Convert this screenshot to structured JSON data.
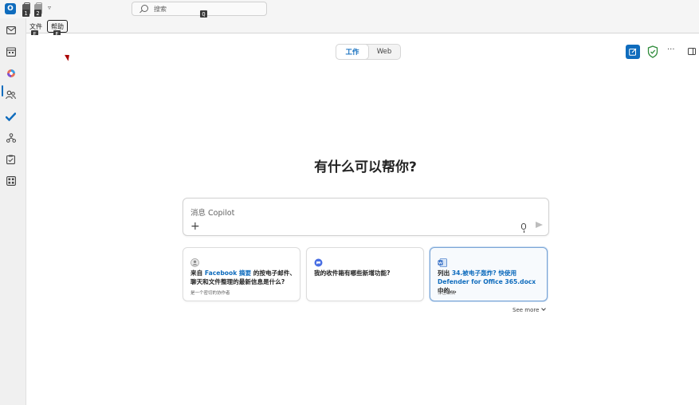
{
  "app": {
    "logo_letter": "O"
  },
  "quick_access": {
    "keytip_1": "1",
    "keytip_2": "2",
    "more": "▿"
  },
  "search": {
    "placeholder": "搜索",
    "keytip": "Q"
  },
  "menu": {
    "file_label": "文件",
    "file_keytip": "F",
    "help_label": "帮助",
    "help_keytip": "E"
  },
  "rail": {
    "items": [
      "mail-icon",
      "calendar-icon",
      "copilot-icon",
      "people-icon",
      "todo-icon",
      "org-icon",
      "tasks-icon",
      "apps-icon"
    ],
    "active": "copilot-icon"
  },
  "toolbar": {
    "tabs": [
      {
        "label": "工作",
        "active": true
      },
      {
        "label": "Web",
        "active": false
      }
    ],
    "more_label": "···"
  },
  "main": {
    "headline": "有什么可以帮你?",
    "composer_placeholder": "消息 Copilot"
  },
  "suggestions": [
    {
      "icon": "person-icon",
      "title_a": "来自 ",
      "title_hl": "Facebook 摘要",
      "title_b": " 的按电子邮件、聊天和文件整理的最新信息是什么?",
      "subtitle": "是一个密切的协作者"
    },
    {
      "icon": "copilot-chat-icon",
      "title_a": "我的收件箱有哪些新增功能?",
      "title_hl": "",
      "title_b": "",
      "subtitle": ""
    },
    {
      "icon": "word-doc-icon",
      "title_a": "列出 ",
      "title_hl": "34.被电子轰炸? 快使用 Defender for Office 365.docx",
      "title_b": " 中的...",
      "subtitle": "你已编辑"
    }
  ],
  "see_more": "See more",
  "colors": {
    "accent": "#0f6cbd",
    "shield": "#2e8b3a"
  }
}
